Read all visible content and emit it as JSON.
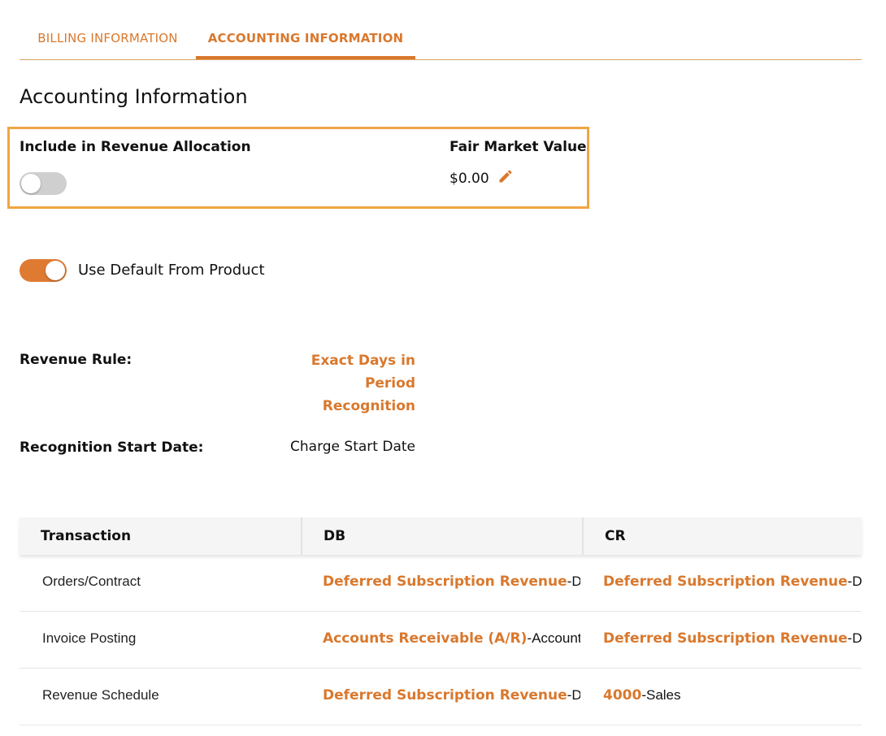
{
  "tabs": [
    {
      "label": "BILLING INFORMATION",
      "active": false
    },
    {
      "label": "ACCOUNTING INFORMATION",
      "active": true
    }
  ],
  "page_title": "Accounting Information",
  "revenue_allocation": {
    "include_label": "Include in Revenue Allocation",
    "include_enabled": false,
    "fmv_label": "Fair Market Value",
    "fmv_value": "$0.00",
    "edit_icon": "pencil-icon"
  },
  "use_default": {
    "label": "Use Default From Product",
    "enabled": true
  },
  "revenue_rule": {
    "label": "Revenue Rule:",
    "value": "Exact Days in Period Recognition"
  },
  "recognition_start": {
    "label": "Recognition Start Date:",
    "value": "Charge Start Date"
  },
  "table": {
    "columns": [
      "Transaction",
      "DB",
      "CR"
    ],
    "rows": [
      {
        "transaction": "Orders/Contract",
        "db": {
          "name": "Deferred Subscription Revenue",
          "desc": "-Deferred Subscription Revenue"
        },
        "cr": {
          "name": "Deferred Subscription Revenue",
          "desc": "-Deferred Subscription Revenue"
        }
      },
      {
        "transaction": "Invoice Posting",
        "db": {
          "name": "Accounts Receivable (A/R)",
          "desc": "-Accounts Receivable"
        },
        "cr": {
          "name": "Deferred Subscription Revenue",
          "desc": "-Deferred Subscription Revenue"
        }
      },
      {
        "transaction": "Revenue Schedule",
        "db": {
          "name": "Deferred Subscription Revenue",
          "desc": "-Deferred Subscription Revenue"
        },
        "cr": {
          "name": "4000",
          "desc": "-Sales"
        }
      }
    ]
  },
  "colors": {
    "accent": "#d9782d",
    "highlight_border": "#f0a542",
    "toggle_off": "#cfcfcf"
  }
}
